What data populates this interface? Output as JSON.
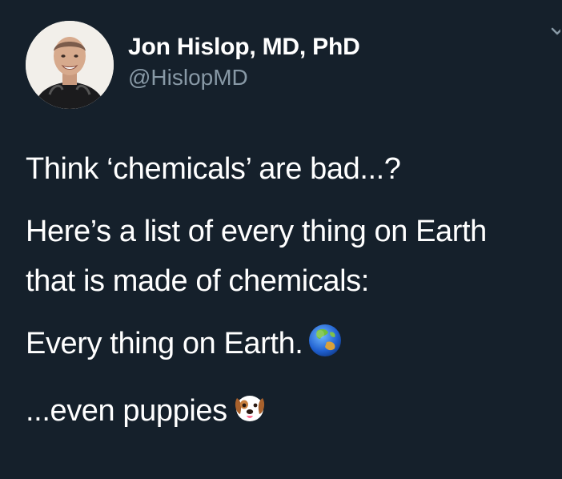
{
  "tweet": {
    "author": {
      "display_name": "Jon Hislop, MD, PhD",
      "handle": "@HislopMD"
    },
    "menu_icon": "chevron-down-icon",
    "lines": [
      "Think ‘chemicals’ are bad...?",
      "Here’s a list of every thing on Earth",
      "that is made of chemicals:",
      "Every thing on Earth.",
      "...even puppies"
    ],
    "emojis": {
      "earth": "globe-asia-australia-icon",
      "puppy": "dog-face-icon"
    }
  }
}
